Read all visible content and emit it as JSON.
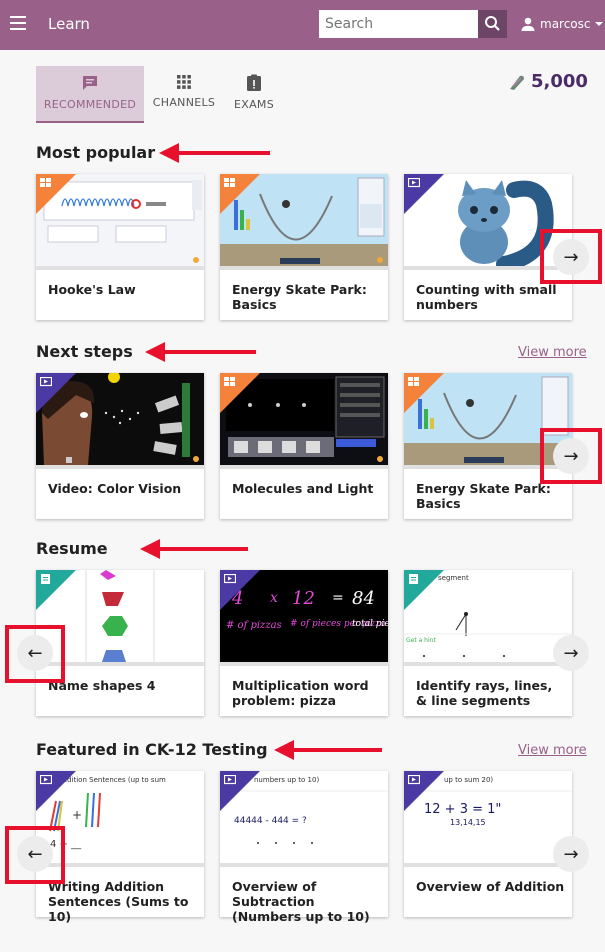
{
  "appbar": {
    "title": "Learn",
    "search_placeholder": "Search",
    "username": "marcosc"
  },
  "tabs": [
    {
      "label": "RECOMMENDED",
      "icon": "recommended-icon",
      "active": true
    },
    {
      "label": "CHANNELS",
      "icon": "channels-icon",
      "active": false
    },
    {
      "label": "EXAMS",
      "icon": "exams-icon",
      "active": false
    }
  ],
  "points": {
    "value": "5,000",
    "icon": "points-icon"
  },
  "sections": [
    {
      "title": "Most popular",
      "view_more": "",
      "cards": [
        {
          "title": "Hooke's Law",
          "kind": "simulation"
        },
        {
          "title": "Energy Skate Park: Basics",
          "kind": "simulation"
        },
        {
          "title": "Counting with small numbers",
          "kind": "video"
        }
      ]
    },
    {
      "title": "Next steps",
      "view_more": "View more",
      "cards": [
        {
          "title": "Video: Color Vision",
          "kind": "video"
        },
        {
          "title": "Molecules and Light",
          "kind": "simulation"
        },
        {
          "title": "Energy Skate Park: Basics",
          "kind": "simulation"
        }
      ]
    },
    {
      "title": "Resume",
      "view_more": "",
      "cards": [
        {
          "title": "Name shapes 4",
          "kind": "exercise"
        },
        {
          "title": "Multiplication word problem: pizza",
          "kind": "video"
        },
        {
          "title": "Identify rays, lines, & line segments",
          "kind": "exercise"
        }
      ]
    },
    {
      "title": "Featured in CK-12 Testing",
      "view_more": "View more",
      "cards": [
        {
          "title": "Writing Addition Sentences (Sums to 10)",
          "kind": "video"
        },
        {
          "title": "Overview of Subtraction (Numbers up to 10)",
          "kind": "video"
        },
        {
          "title": "Overview of Addition",
          "kind": "video"
        }
      ]
    }
  ],
  "thumb_text": {
    "pizza_a": "4",
    "pizza_b": "12",
    "pizza_c": "84",
    "pizza_label1": "# of pizzas",
    "pizza_label2": "# of pieces per pizza",
    "pizza_label3": "total pieces",
    "addition_head": "Addition Sentences (up to sum",
    "addition_eq": "4 + __",
    "subtraction_head": "numbers up to 10)",
    "subtraction_eq": "44444 - 444 = ?",
    "overview_head": "up to sum 20)",
    "overview_eq": "12 + 3 = 1\"",
    "overview_count": "13,14,15",
    "rays_head": "segment",
    "rays_hint": "Get a hint"
  },
  "colors": {
    "brand": "#996189",
    "accent_red": "#e8112d",
    "simulation": "#f4823a",
    "video": "#4b3aa3",
    "exercise": "#23a99b"
  }
}
